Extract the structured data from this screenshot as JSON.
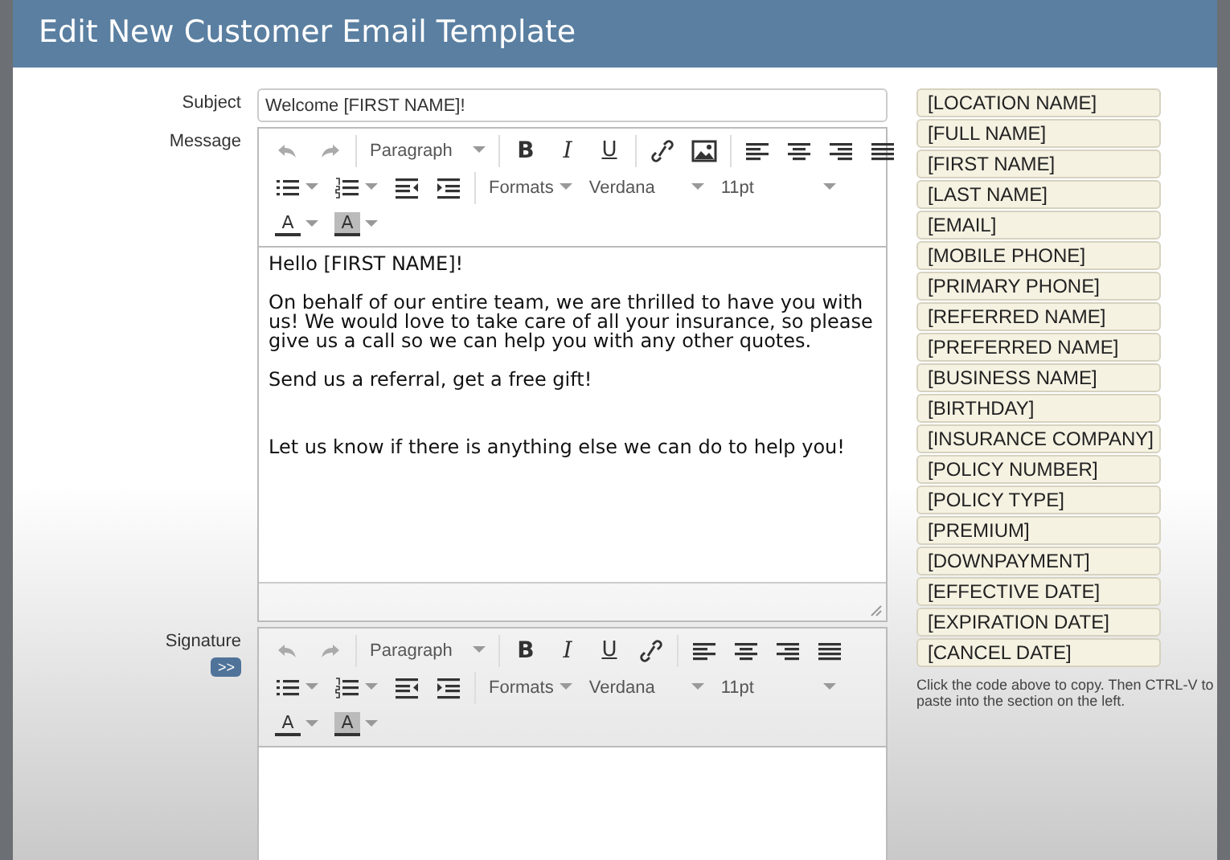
{
  "window": {
    "title": "Edit New Customer Email Template"
  },
  "subject": {
    "label": "Subject",
    "value": "Welcome [FIRST NAME]!"
  },
  "message": {
    "label": "Message",
    "toolbar": [
      [
        [
          {
            "kind": "undo"
          },
          {
            "kind": "redo"
          }
        ],
        [
          {
            "kind": "select",
            "label": "Paragraph"
          }
        ],
        [
          {
            "kind": "bold",
            "label": "B"
          },
          {
            "kind": "italic",
            "label": "I"
          },
          {
            "kind": "underline",
            "label": "U"
          }
        ],
        [
          {
            "kind": "link"
          },
          {
            "kind": "image"
          }
        ],
        [
          {
            "kind": "align-left"
          },
          {
            "kind": "align-center"
          },
          {
            "kind": "align-right"
          },
          {
            "kind": "justify"
          }
        ]
      ],
      [
        [
          {
            "kind": "bullet-list"
          },
          {
            "kind": "number-list"
          },
          {
            "kind": "outdent"
          },
          {
            "kind": "indent"
          }
        ],
        [
          {
            "kind": "menu",
            "label": "Formats"
          },
          {
            "kind": "select",
            "label": "Verdana"
          },
          {
            "kind": "select",
            "label": "11pt"
          }
        ]
      ],
      [
        [
          {
            "kind": "text-color",
            "label": "A"
          },
          {
            "kind": "background-color",
            "label": "A"
          }
        ]
      ]
    ],
    "paragraphs": [
      "Hello [FIRST NAME]!",
      "On behalf of our entire team, we are thrilled to have you with us! We would love to take care of all your insurance, so please give us a call so we can help you with any other quotes.",
      "Send us a referral, get a free gift!",
      "Let us know if there is anything else we can do to help you!"
    ]
  },
  "signature": {
    "label": "Signature",
    "expand_button": ">>",
    "toolbar": [
      [
        [
          {
            "kind": "undo"
          },
          {
            "kind": "redo"
          }
        ],
        [
          {
            "kind": "select",
            "label": "Paragraph"
          }
        ],
        [
          {
            "kind": "bold",
            "label": "B"
          },
          {
            "kind": "italic",
            "label": "I"
          },
          {
            "kind": "underline",
            "label": "U"
          },
          {
            "kind": "link"
          }
        ],
        [
          {
            "kind": "align-left"
          },
          {
            "kind": "align-center"
          },
          {
            "kind": "align-right"
          },
          {
            "kind": "justify"
          }
        ]
      ],
      [
        [
          {
            "kind": "bullet-list"
          },
          {
            "kind": "number-list"
          },
          {
            "kind": "outdent"
          },
          {
            "kind": "indent"
          }
        ],
        [
          {
            "kind": "menu",
            "label": "Formats"
          },
          {
            "kind": "select",
            "label": "Verdana"
          },
          {
            "kind": "select",
            "label": "11pt"
          }
        ]
      ],
      [
        [
          {
            "kind": "text-color",
            "label": "A"
          },
          {
            "kind": "background-color",
            "label": "A"
          }
        ]
      ]
    ]
  },
  "codes": [
    "[LOCATION NAME]",
    "[FULL NAME]",
    "[FIRST NAME]",
    "[LAST NAME]",
    "[EMAIL]",
    "[MOBILE PHONE]",
    "[PRIMARY PHONE]",
    "[REFERRED NAME]",
    "[PREFERRED NAME]",
    "[BUSINESS NAME]",
    "[BIRTHDAY]",
    "[INSURANCE COMPANY]",
    "[POLICY NUMBER]",
    "[POLICY TYPE]",
    "[PREMIUM]",
    "[DOWNPAYMENT]",
    "[EFFECTIVE DATE]",
    "[EXPIRATION DATE]",
    "[CANCEL DATE]"
  ],
  "hint": "Click the code above to copy. Then CTRL-V to paste into the section on the left."
}
